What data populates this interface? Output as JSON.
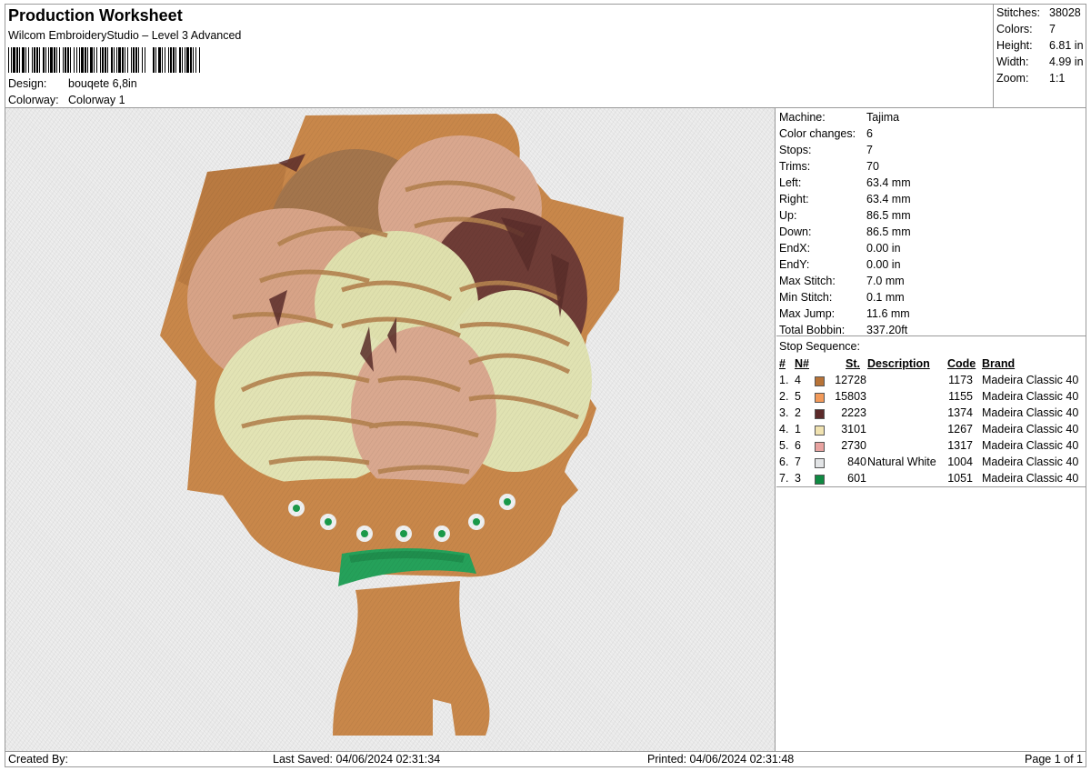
{
  "header": {
    "title": "Production Worksheet",
    "subtitle": "Wilcom EmbroideryStudio – Level 3 Advanced",
    "design_label": "Design:",
    "design_value": "bouqete 6,8in",
    "colorway_label": "Colorway:",
    "colorway_value": "Colorway 1"
  },
  "summary": {
    "stitches_label": "Stitches:",
    "stitches": "38028",
    "colors_label": "Colors:",
    "colors": "7",
    "height_label": "Height:",
    "height": "6.81 in",
    "width_label": "Width:",
    "width": "4.99 in",
    "zoom_label": "Zoom:",
    "zoom": "1:1"
  },
  "machine": [
    {
      "label": "Machine:",
      "value": "Tajima"
    },
    {
      "label": "Color changes:",
      "value": "6"
    },
    {
      "label": "Stops:",
      "value": "7"
    },
    {
      "label": "Trims:",
      "value": "70"
    },
    {
      "label": "Left:",
      "value": "63.4 mm"
    },
    {
      "label": "Right:",
      "value": "63.4 mm"
    },
    {
      "label": "Up:",
      "value": "86.5 mm"
    },
    {
      "label": "Down:",
      "value": "86.5 mm"
    },
    {
      "label": "EndX:",
      "value": "0.00 in"
    },
    {
      "label": "EndY:",
      "value": "0.00 in"
    },
    {
      "label": "Max Stitch:",
      "value": "7.0 mm"
    },
    {
      "label": "Min Stitch:",
      "value": "0.1 mm"
    },
    {
      "label": "Max Jump:",
      "value": "11.6 mm"
    },
    {
      "label": "Total Bobbin:",
      "value": "337.20ft"
    }
  ],
  "stop_sequence": {
    "title": "Stop Sequence:",
    "headers": {
      "num": "#",
      "n": "N#",
      "st": "St.",
      "description": "Description",
      "code": "Code",
      "brand": "Brand"
    },
    "rows": [
      {
        "num": "1.",
        "n": "4",
        "color": "#b87337",
        "st": "12728",
        "description": "",
        "code": "1173",
        "brand": "Madeira Classic 40"
      },
      {
        "num": "2.",
        "n": "5",
        "color": "#f29a5a",
        "st": "15803",
        "description": "",
        "code": "1155",
        "brand": "Madeira Classic 40"
      },
      {
        "num": "3.",
        "n": "2",
        "color": "#5c2a2a",
        "st": "2223",
        "description": "",
        "code": "1374",
        "brand": "Madeira Classic 40"
      },
      {
        "num": "4.",
        "n": "1",
        "color": "#f0e2b0",
        "st": "3101",
        "description": "",
        "code": "1267",
        "brand": "Madeira Classic 40"
      },
      {
        "num": "5.",
        "n": "6",
        "color": "#e8a3a0",
        "st": "2730",
        "description": "",
        "code": "1317",
        "brand": "Madeira Classic 40"
      },
      {
        "num": "6.",
        "n": "7",
        "color": "#e2e4e6",
        "st": "840",
        "description": "Natural White",
        "code": "1004",
        "brand": "Madeira Classic 40"
      },
      {
        "num": "7.",
        "n": "3",
        "color": "#0f8a42",
        "st": "601",
        "description": "",
        "code": "1051",
        "brand": "Madeira Classic 40"
      }
    ]
  },
  "footer": {
    "created_by": "Created By:",
    "last_saved": "Last Saved: 04/06/2024 02:31:34",
    "printed": "Printed: 04/06/2024 02:31:48",
    "page": "Page 1 of 1"
  },
  "colors": {
    "wrap": "#c8874a",
    "wrap_dark": "#a96e38",
    "ribbon": "#25a15a",
    "concha_pink": "#dba88f",
    "concha_cream": "#e6e7b6",
    "concha_brown": "#6e3c36"
  }
}
